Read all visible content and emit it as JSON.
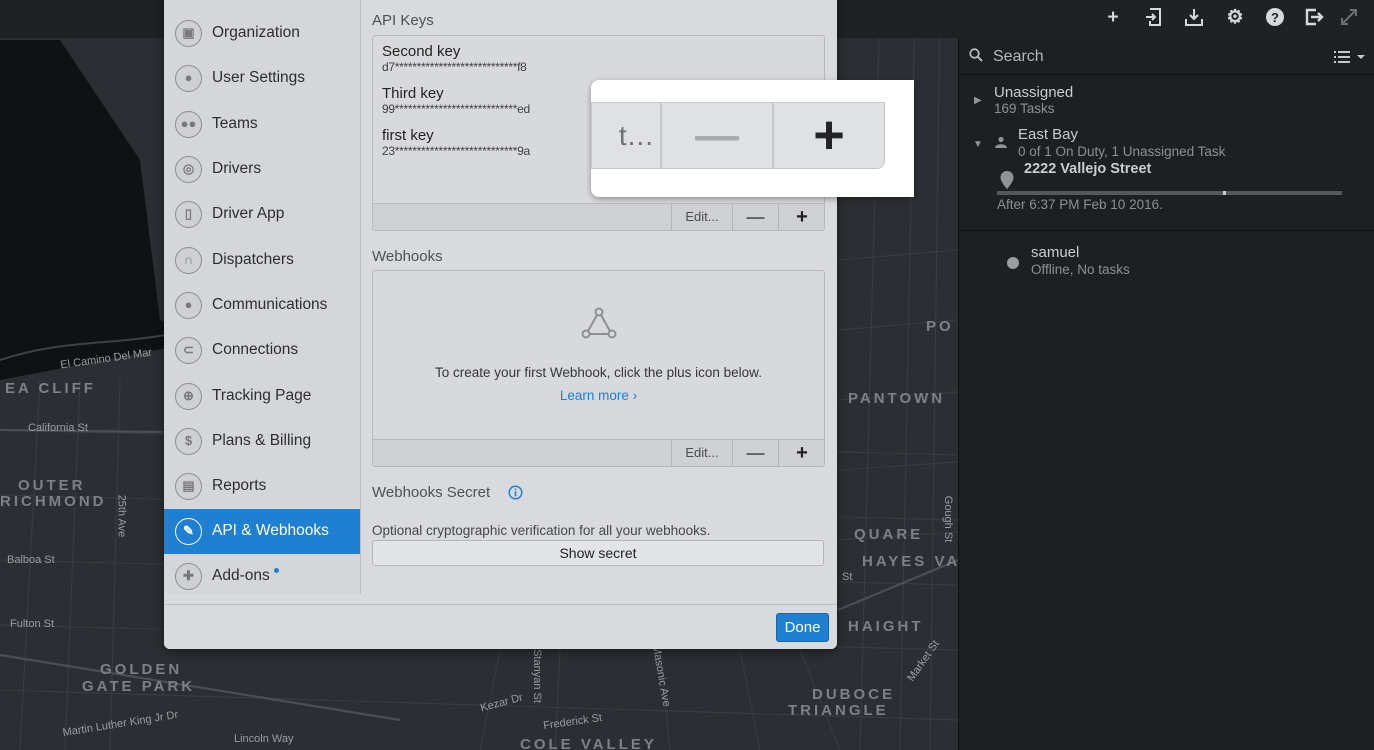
{
  "map": {
    "areas": [
      "EA CLIFF",
      "OUTER",
      "RICHMOND",
      "GOLDEN",
      "GATE PARK",
      "PANTOWN",
      "QUARE",
      "HAYES VA",
      "HAIGHT",
      "DUBOCE",
      "TRIANGLE",
      "COLE VALLEY",
      "PO"
    ],
    "streets": [
      "El Camino Del Mar",
      "California St",
      "25th Ave",
      "Balboa St",
      "Fulton St",
      "Martin Luther King Jr Dr",
      "Lincoln Way",
      "Kezar Dr",
      "Stanyan St",
      "Frederick St",
      "Masonic Ave",
      "Gough St",
      "Market St",
      "St"
    ]
  },
  "topbar": {
    "icons": [
      "plus-icon",
      "import-icon",
      "download-icon",
      "gear-icon",
      "help-icon",
      "logout-icon",
      "fullscreen-icon"
    ]
  },
  "right_panel": {
    "search_placeholder": "Search",
    "groups": [
      {
        "title": "Unassigned",
        "subtitle": "169 Tasks"
      },
      {
        "title": "East Bay",
        "subtitle": "0 of 1 On Duty, 1 Unassigned Task"
      }
    ],
    "task": {
      "address": "2222 Vallejo Street",
      "time": "After 6:37 PM Feb 10 2016."
    },
    "worker": {
      "name": "samuel",
      "status": "Offline, No tasks"
    }
  },
  "sidebar": {
    "items": [
      {
        "label": "Organization",
        "icon": "briefcase-icon",
        "glyph": "▣"
      },
      {
        "label": "User Settings",
        "icon": "user-icon",
        "glyph": "●"
      },
      {
        "label": "Teams",
        "icon": "team-icon",
        "glyph": "●●"
      },
      {
        "label": "Drivers",
        "icon": "steering-wheel-icon",
        "glyph": "◎"
      },
      {
        "label": "Driver App",
        "icon": "phone-icon",
        "glyph": "▯"
      },
      {
        "label": "Dispatchers",
        "icon": "headset-icon",
        "glyph": "∩"
      },
      {
        "label": "Communications",
        "icon": "chat-icon",
        "glyph": "●"
      },
      {
        "label": "Connections",
        "icon": "connection-icon",
        "glyph": "⊂"
      },
      {
        "label": "Tracking Page",
        "icon": "target-icon",
        "glyph": "⊕"
      },
      {
        "label": "Plans & Billing",
        "icon": "dollar-icon",
        "glyph": "$"
      },
      {
        "label": "Reports",
        "icon": "report-icon",
        "glyph": "▤"
      },
      {
        "label": "API & Webhooks",
        "icon": "wrench-icon",
        "glyph": "✎"
      },
      {
        "label": "Add-ons",
        "icon": "puzzle-icon",
        "glyph": "✚"
      }
    ],
    "active_index": 11
  },
  "api_keys": {
    "title": "API Keys",
    "keys": [
      {
        "name": "Second key",
        "value": "d7****************************f8"
      },
      {
        "name": "Third key",
        "value": "99****************************ed"
      },
      {
        "name": "first key",
        "value": "23****************************9a"
      }
    ],
    "edit_label": "Edit...",
    "minus_label": "—",
    "plus_label": "+"
  },
  "webhooks": {
    "title": "Webhooks",
    "empty_text": "To create your first Webhook, click the plus icon below.",
    "learn_more": "Learn more ›",
    "edit_label": "Edit...",
    "minus_label": "—",
    "plus_label": "+"
  },
  "secret": {
    "title": "Webhooks Secret",
    "description": "Optional cryptographic verification for all your webhooks.",
    "button": "Show secret"
  },
  "footer": {
    "done_label": "Done"
  },
  "zoom": {
    "edit_fragment": "t...",
    "minus_label": "—",
    "plus_label": "+"
  },
  "colors": {
    "accent": "#1f7fd0",
    "modal_bg": "#d9dadd",
    "panel_bg": "#1d1f21"
  }
}
